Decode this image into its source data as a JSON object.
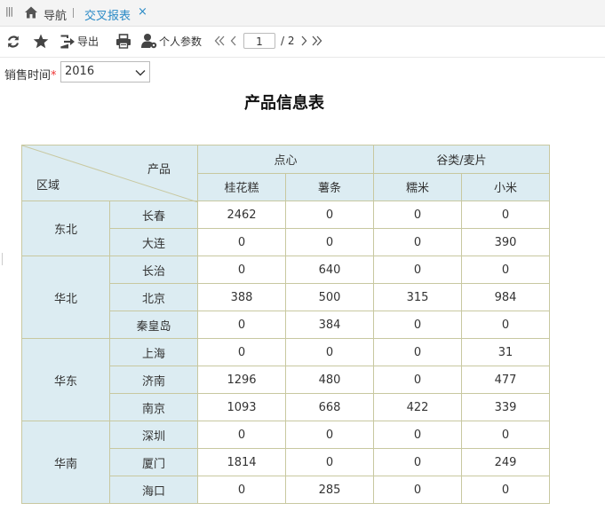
{
  "tabs": {
    "nav_label": "导航",
    "active_tab_label": "交叉报表",
    "close_symbol": "×"
  },
  "toolbar": {
    "refresh_icon": "refresh-icon",
    "favorite_icon": "star-icon",
    "export_label": "导出",
    "print_icon": "printer-icon",
    "personal_params_label": "个人参数",
    "current_page": "1",
    "total_pages": "/ 2"
  },
  "filter": {
    "label": "销售时间",
    "required_mark": "*",
    "selected_value": "2016"
  },
  "report": {
    "title": "产品信息表",
    "corner_product": "产品",
    "corner_area": "区域",
    "groups": [
      {
        "label": "点心",
        "products": [
          "桂花糕",
          "薯条"
        ]
      },
      {
        "label": "谷类/麦片",
        "products": [
          "糯米",
          "小米"
        ]
      }
    ],
    "regions": [
      {
        "name": "东北",
        "cities": [
          {
            "name": "长春",
            "values": [
              "2462",
              "0",
              "0",
              "0"
            ]
          },
          {
            "name": "大连",
            "values": [
              "0",
              "0",
              "0",
              "390"
            ]
          }
        ]
      },
      {
        "name": "华北",
        "cities": [
          {
            "name": "长治",
            "values": [
              "0",
              "640",
              "0",
              "0"
            ]
          },
          {
            "name": "北京",
            "values": [
              "388",
              "500",
              "315",
              "984"
            ]
          },
          {
            "name": "秦皇岛",
            "values": [
              "0",
              "384",
              "0",
              "0"
            ]
          }
        ]
      },
      {
        "name": "华东",
        "cities": [
          {
            "name": "上海",
            "values": [
              "0",
              "0",
              "0",
              "31"
            ]
          },
          {
            "name": "济南",
            "values": [
              "1296",
              "480",
              "0",
              "477"
            ]
          },
          {
            "name": "南京",
            "values": [
              "1093",
              "668",
              "422",
              "339"
            ]
          }
        ]
      },
      {
        "name": "华南",
        "cities": [
          {
            "name": "深圳",
            "values": [
              "0",
              "0",
              "0",
              "0"
            ]
          },
          {
            "name": "厦门",
            "values": [
              "1814",
              "0",
              "0",
              "249"
            ]
          },
          {
            "name": "海口",
            "values": [
              "0",
              "285",
              "0",
              "0"
            ]
          }
        ]
      }
    ]
  },
  "colors": {
    "header_bg": "#dcecf2",
    "grid_border": "#c8c8a0",
    "tab_active": "#2a8ac6"
  }
}
